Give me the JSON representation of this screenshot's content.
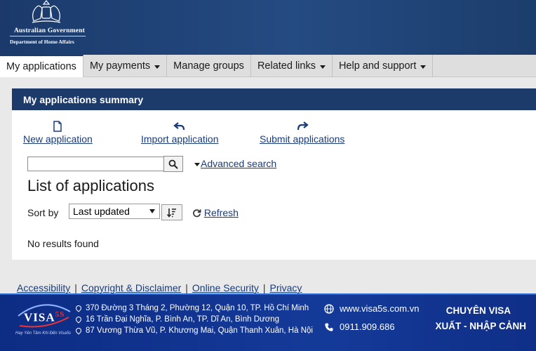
{
  "header": {
    "gov_line1": "Australian Government",
    "gov_line2": "Department of Home Affairs",
    "bg_color": "#1b3a6b"
  },
  "nav": {
    "items": [
      {
        "label": "My applications",
        "active": true,
        "dropdown": false
      },
      {
        "label": "My payments",
        "active": false,
        "dropdown": true
      },
      {
        "label": "Manage groups",
        "active": false,
        "dropdown": false
      },
      {
        "label": "Related links",
        "active": false,
        "dropdown": true
      },
      {
        "label": "Help and support",
        "active": false,
        "dropdown": true
      }
    ]
  },
  "panel": {
    "title": "My applications summary",
    "actions": [
      {
        "label": "New application",
        "icon": "document-icon"
      },
      {
        "label": "Import application",
        "icon": "import-arrow-icon"
      },
      {
        "label": "Submit applications",
        "icon": "submit-arrow-icon"
      }
    ],
    "search": {
      "value": "",
      "advanced_label": "Advanced search"
    },
    "list_title": "List of applications",
    "sort": {
      "label": "Sort by",
      "selected": "Last updated",
      "refresh_label": "Refresh"
    },
    "no_results": "No results found"
  },
  "footer_links": [
    "Accessibility",
    "Copyright & Disclaimer",
    "Online Security",
    "Privacy"
  ],
  "banner": {
    "logo_text": "VISA",
    "logo_suffix": "5S",
    "logo_tagline": "Hay Yên Tâm Khi Đến Visa5s",
    "addresses": [
      "370 Đường 3 Tháng 2, Phường 12, Quận 10, TP. Hồ Chí Minh",
      "16 Trần Đại Nghĩa, P. Bình An, TP. Dĩ An, Bình Dương",
      "87 Vương Thừa Vũ, P. Khương Mai, Quận Thanh Xuân, Hà Nội"
    ],
    "website": "www.visa5s.com.vn",
    "phone": "0911.909.686",
    "promo_line1": "CHUYÊN VISA",
    "promo_line2": "XUẤT - NHẬP CẢNH",
    "bg_color": "#0d2c84"
  }
}
